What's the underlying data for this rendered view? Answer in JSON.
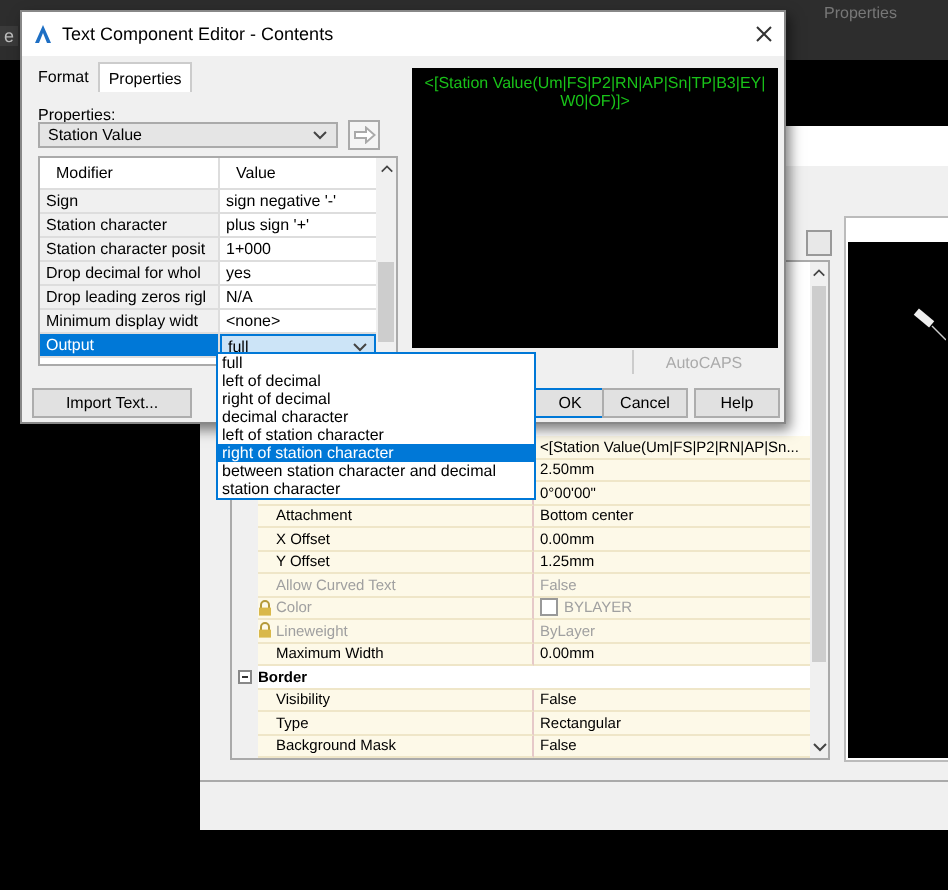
{
  "background_app": {
    "tab_fragment": "e",
    "ribbon_label": "Properties"
  },
  "back_dialog": {
    "rows": [
      {
        "kind": "property",
        "value": "<[Station Value(Um|FS|P2|RN|AP|Sn...",
        "disabled": false,
        "locked": false
      },
      {
        "kind": "property",
        "value": "2.50mm",
        "disabled": false,
        "locked": false
      },
      {
        "kind": "property",
        "value": "0°00'00\"",
        "disabled": false,
        "locked": false
      },
      {
        "kind": "property",
        "name": "Attachment",
        "value": "Bottom center",
        "disabled": false,
        "locked": false
      },
      {
        "kind": "property",
        "name": "X Offset",
        "value": "0.00mm",
        "disabled": false,
        "locked": false
      },
      {
        "kind": "property",
        "name": "Y Offset",
        "value": "1.25mm",
        "disabled": false,
        "locked": false
      },
      {
        "kind": "property",
        "name": "Allow Curved Text",
        "value": "False",
        "disabled": true,
        "locked": false
      },
      {
        "kind": "color",
        "name": "Color",
        "value": "BYLAYER",
        "disabled": true,
        "locked": true
      },
      {
        "kind": "property",
        "name": "Lineweight",
        "value": "ByLayer",
        "disabled": true,
        "locked": true
      },
      {
        "kind": "property",
        "name": "Maximum Width",
        "value": "0.00mm",
        "disabled": false,
        "locked": false
      },
      {
        "kind": "group",
        "name": "Border",
        "expanded": true
      },
      {
        "kind": "property",
        "name": "Visibility",
        "value": "False",
        "disabled": false,
        "locked": false
      },
      {
        "kind": "property",
        "name": "Type",
        "value": "Rectangular",
        "disabled": false,
        "locked": false
      },
      {
        "kind": "property",
        "name": "Background Mask",
        "value": "False",
        "disabled": false,
        "locked": false
      }
    ]
  },
  "dialog": {
    "title": "Text Component Editor - Contents",
    "tabs": [
      {
        "label": "Format",
        "selected": false
      },
      {
        "label": "Properties",
        "selected": true
      }
    ],
    "properties_label": "Properties:",
    "property_select": "Station Value",
    "grid": {
      "columns": [
        "Modifier",
        "Value"
      ],
      "rows": [
        {
          "kind": "text",
          "name": "Sign",
          "value": "sign negative '-'",
          "selected": false
        },
        {
          "kind": "text",
          "name": "Station character",
          "value": "plus sign '+'",
          "selected": false
        },
        {
          "kind": "text",
          "name": "Station character posit",
          "value": "1+000",
          "selected": false
        },
        {
          "kind": "text",
          "name": "Drop decimal for whol",
          "value": "yes",
          "selected": false
        },
        {
          "kind": "text",
          "name": "Drop leading zeros rigl",
          "value": "N/A",
          "selected": false
        },
        {
          "kind": "text",
          "name": "Minimum display widt",
          "value": "<none>",
          "selected": false
        },
        {
          "kind": "combo",
          "name": "Output",
          "value": "full",
          "selected": true
        }
      ]
    },
    "dropdown_options": [
      {
        "label": "full",
        "selected": false
      },
      {
        "label": "left of decimal",
        "selected": false
      },
      {
        "label": "right of decimal",
        "selected": false
      },
      {
        "label": "decimal character",
        "selected": false
      },
      {
        "label": "left of station character",
        "selected": false
      },
      {
        "label": "right of station character",
        "selected": true
      },
      {
        "label": "between station character and decimal",
        "selected": false
      },
      {
        "label": "station character",
        "selected": false
      }
    ],
    "preview_text": "<[Station Value(Um|FS|P2|RN|AP|Sn|TP|B3|EY|W0|OF)]>",
    "autocaps_label": "AutoCAPS",
    "buttons": [
      {
        "kind": "import",
        "label": "Import Text..."
      },
      {
        "kind": "ok",
        "label": "OK"
      },
      {
        "kind": "cancel",
        "label": "Cancel"
      },
      {
        "kind": "help",
        "label": "Help"
      }
    ]
  }
}
